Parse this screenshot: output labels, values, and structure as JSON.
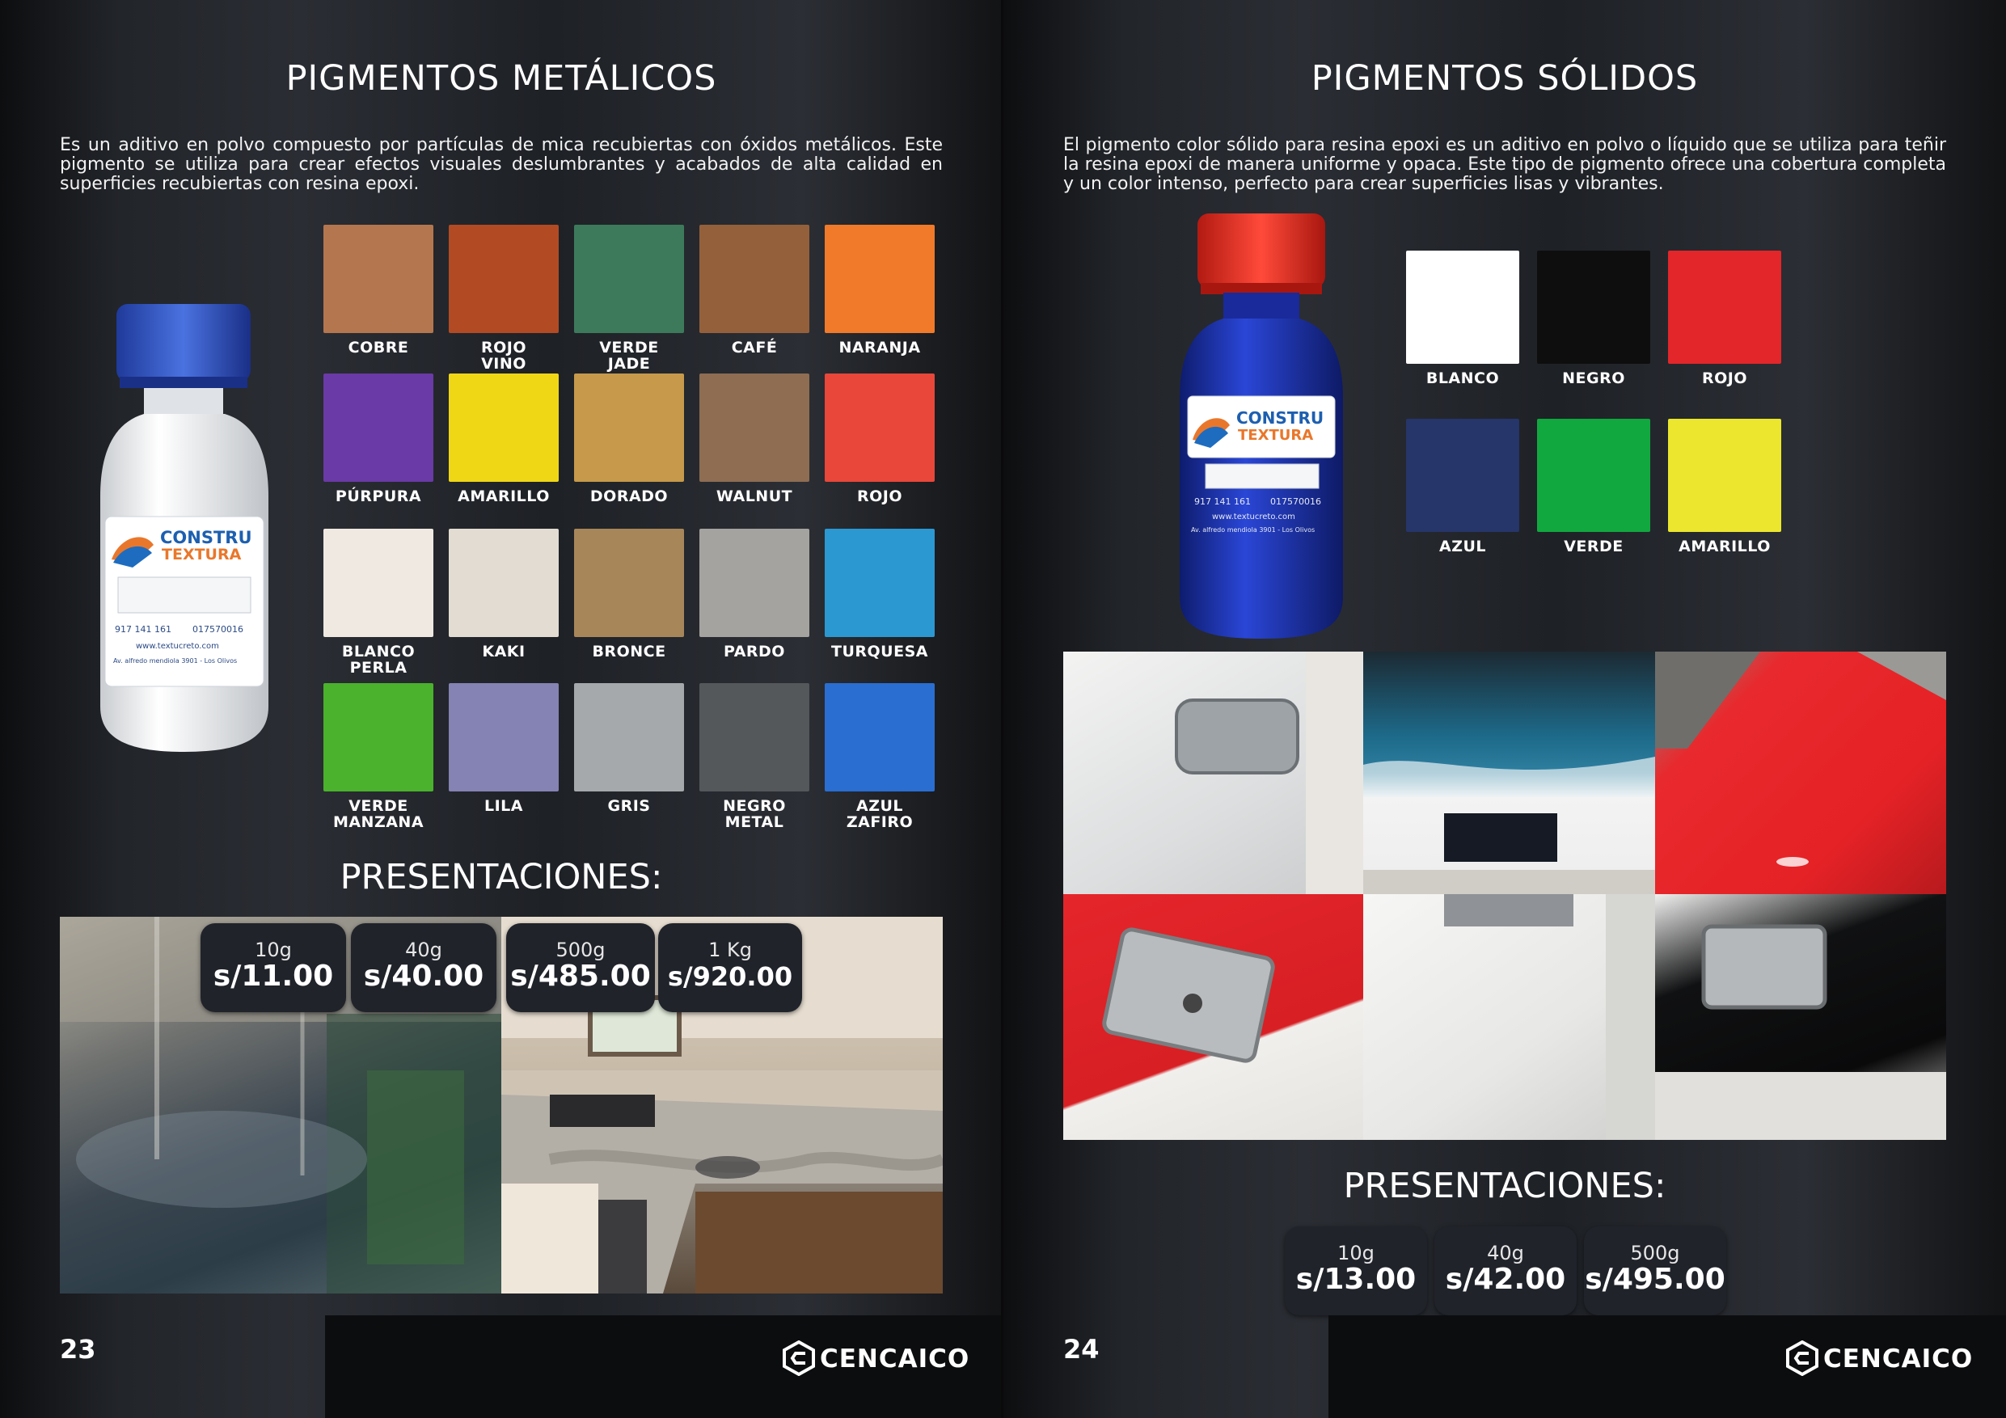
{
  "left": {
    "title": "PIGMENTOS METÁLICOS",
    "description": "Es un aditivo en polvo compuesto por partículas de mica recubiertas con óxidos metálicos. Este pigmento se utiliza para crear efectos visuales deslumbrantes y acabados de alta calidad en superficies recubiertas con resina epoxi.",
    "bottle": {
      "brand_line1": "CONSTRU",
      "brand_line2": "TEXTURA",
      "phone": "917 141 161",
      "phone2": "017570016",
      "web": "www.textucreto.com",
      "address": "Av. alfredo mendiola 3901 - Los Olivos",
      "cap_color": "#2a4fc0",
      "body_color": "#eef0f2"
    },
    "swatches": [
      {
        "label": "COBRE",
        "color": "#b4764f"
      },
      {
        "label": "ROJO\nVINO",
        "color": "#b24a23"
      },
      {
        "label": "VERDE\nJADE",
        "color": "#3d7a5c"
      },
      {
        "label": "CAFÉ",
        "color": "#94603b"
      },
      {
        "label": "NARANJA",
        "color": "#f07a2a"
      },
      {
        "label": "PÚRPURA",
        "color": "#6a3aa6"
      },
      {
        "label": "AMARILLO",
        "color": "#efd716"
      },
      {
        "label": "DORADO",
        "color": "#c69a4a"
      },
      {
        "label": "WALNUT",
        "color": "#8e6d52"
      },
      {
        "label": "ROJO",
        "color": "#e8473a"
      },
      {
        "label": "BLANCO\nPERLA",
        "color": "#efe9e2"
      },
      {
        "label": "KAKI",
        "color": "#e2dcd2"
      },
      {
        "label": "BRONCE",
        "color": "#a7865a"
      },
      {
        "label": "PARDO",
        "color": "#a4a39f"
      },
      {
        "label": "TURQUESA",
        "color": "#2c98d2"
      },
      {
        "label": "VERDE\nMANZANA",
        "color": "#4ab22c"
      },
      {
        "label": "LILA",
        "color": "#8582b4"
      },
      {
        "label": "GRIS",
        "color": "#a5a9ab"
      },
      {
        "label": "NEGRO\nMETAL",
        "color": "#55585b"
      },
      {
        "label": "AZUL\nZAFIRO",
        "color": "#2a6ed1"
      }
    ],
    "presentations_title": "PRESENTACIONES:",
    "prices": [
      {
        "weight": "10g",
        "price": "s/11.00"
      },
      {
        "weight": "40g",
        "price": "s/40.00"
      },
      {
        "weight": "500g",
        "price": "s/485.00"
      },
      {
        "weight": "1 Kg",
        "price": "s/920.00"
      }
    ],
    "page_number": "23",
    "logo": "CENCAICO"
  },
  "right": {
    "title": "PIGMENTOS SÓLIDOS",
    "description": "El pigmento color sólido para resina epoxi es un aditivo en polvo o líquido que se utiliza para teñir la resina epoxi de manera uniforme y opaca. Este tipo de pigmento ofrece una cobertura completa y un color intenso, perfecto para crear superficies lisas y vibrantes.",
    "bottle": {
      "brand_line1": "CONSTRU",
      "brand_line2": "TEXTURA",
      "phone": "917 141 161",
      "phone2": "017570016",
      "web": "www.textucreto.com",
      "address": "Av. alfredo mendiola 3901 - Los Olivos",
      "cap_color": "#e52a1e",
      "body_color": "#1b34b5"
    },
    "swatches": [
      {
        "label": "BLANCO",
        "color": "#ffffff"
      },
      {
        "label": "NEGRO",
        "color": "#0e0e0f"
      },
      {
        "label": "ROJO",
        "color": "#e3262a"
      },
      {
        "label": "AZUL",
        "color": "#26356a"
      },
      {
        "label": "VERDE",
        "color": "#11a840"
      },
      {
        "label": "AMARILLO",
        "color": "#ece72e"
      }
    ],
    "presentations_title": "PRESENTACIONES:",
    "prices": [
      {
        "weight": "10g",
        "price": "s/13.00"
      },
      {
        "weight": "40g",
        "price": "s/42.00"
      },
      {
        "weight": "500g",
        "price": "s/495.00"
      }
    ],
    "page_number": "24",
    "logo": "CENCAICO"
  }
}
